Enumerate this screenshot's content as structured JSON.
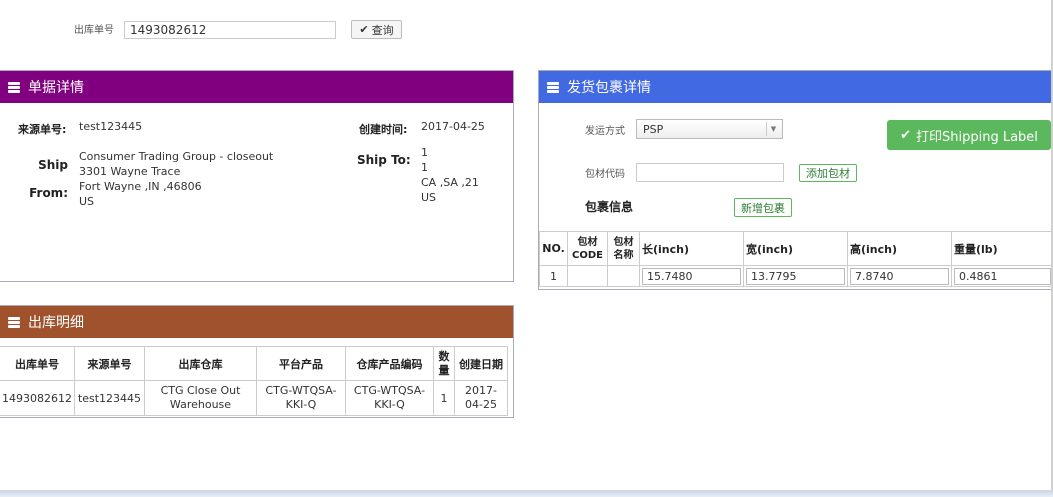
{
  "search": {
    "label": "出库单号",
    "value": "1493082612",
    "button": "查询"
  },
  "doc_panel": {
    "title": "单据详情",
    "source_no_label": "来源单号:",
    "source_no": "test123445",
    "created_label": "创建时间:",
    "created": "2017-04-25",
    "ship_from_label": "Ship From:",
    "ship_from_lines": [
      "Consumer Trading Group - closeout",
      "3301 Wayne Trace",
      "Fort Wayne ,IN ,46806",
      "US"
    ],
    "ship_to_label": "Ship To:",
    "ship_to_lines": [
      "1",
      "1",
      "CA ,SA ,21",
      "US"
    ]
  },
  "outbound_panel": {
    "title": "出库明细",
    "columns": [
      "出库单号",
      "来源单号",
      "出库仓库",
      "平台产品",
      "仓库产品编码",
      "数量",
      "创建日期"
    ],
    "rows": [
      [
        "1493082612",
        "test123445",
        "CTG Close Out Warehouse",
        "CTG-WTQSA-KKI-Q",
        "CTG-WTQSA-KKI-Q",
        "1",
        "2017-04-25"
      ]
    ]
  },
  "package_panel": {
    "title": "发货包裹详情",
    "ship_method_label": "发运方式",
    "ship_method_value": "PSP",
    "print_button": "打印Shipping Label",
    "material_label": "包材代码",
    "material_value": "",
    "add_material_button": "添加包材",
    "package_info_label": "包裹信息",
    "add_package_button": "新增包裹",
    "columns": [
      "NO.",
      "包材CODE",
      "包材名称",
      "长(inch)",
      "宽(inch)",
      "高(inch)",
      "重量(lb)"
    ],
    "rows": [
      {
        "no": "1",
        "code": "",
        "name": "",
        "length": "15.7480",
        "width": "13.7795",
        "height": "7.8740",
        "weight": "0.4861"
      }
    ]
  },
  "colors": {
    "doc_header": "#800080",
    "package_header": "#4169e1",
    "outbound_header": "#a0522d",
    "print_button": "#5cb85c"
  }
}
